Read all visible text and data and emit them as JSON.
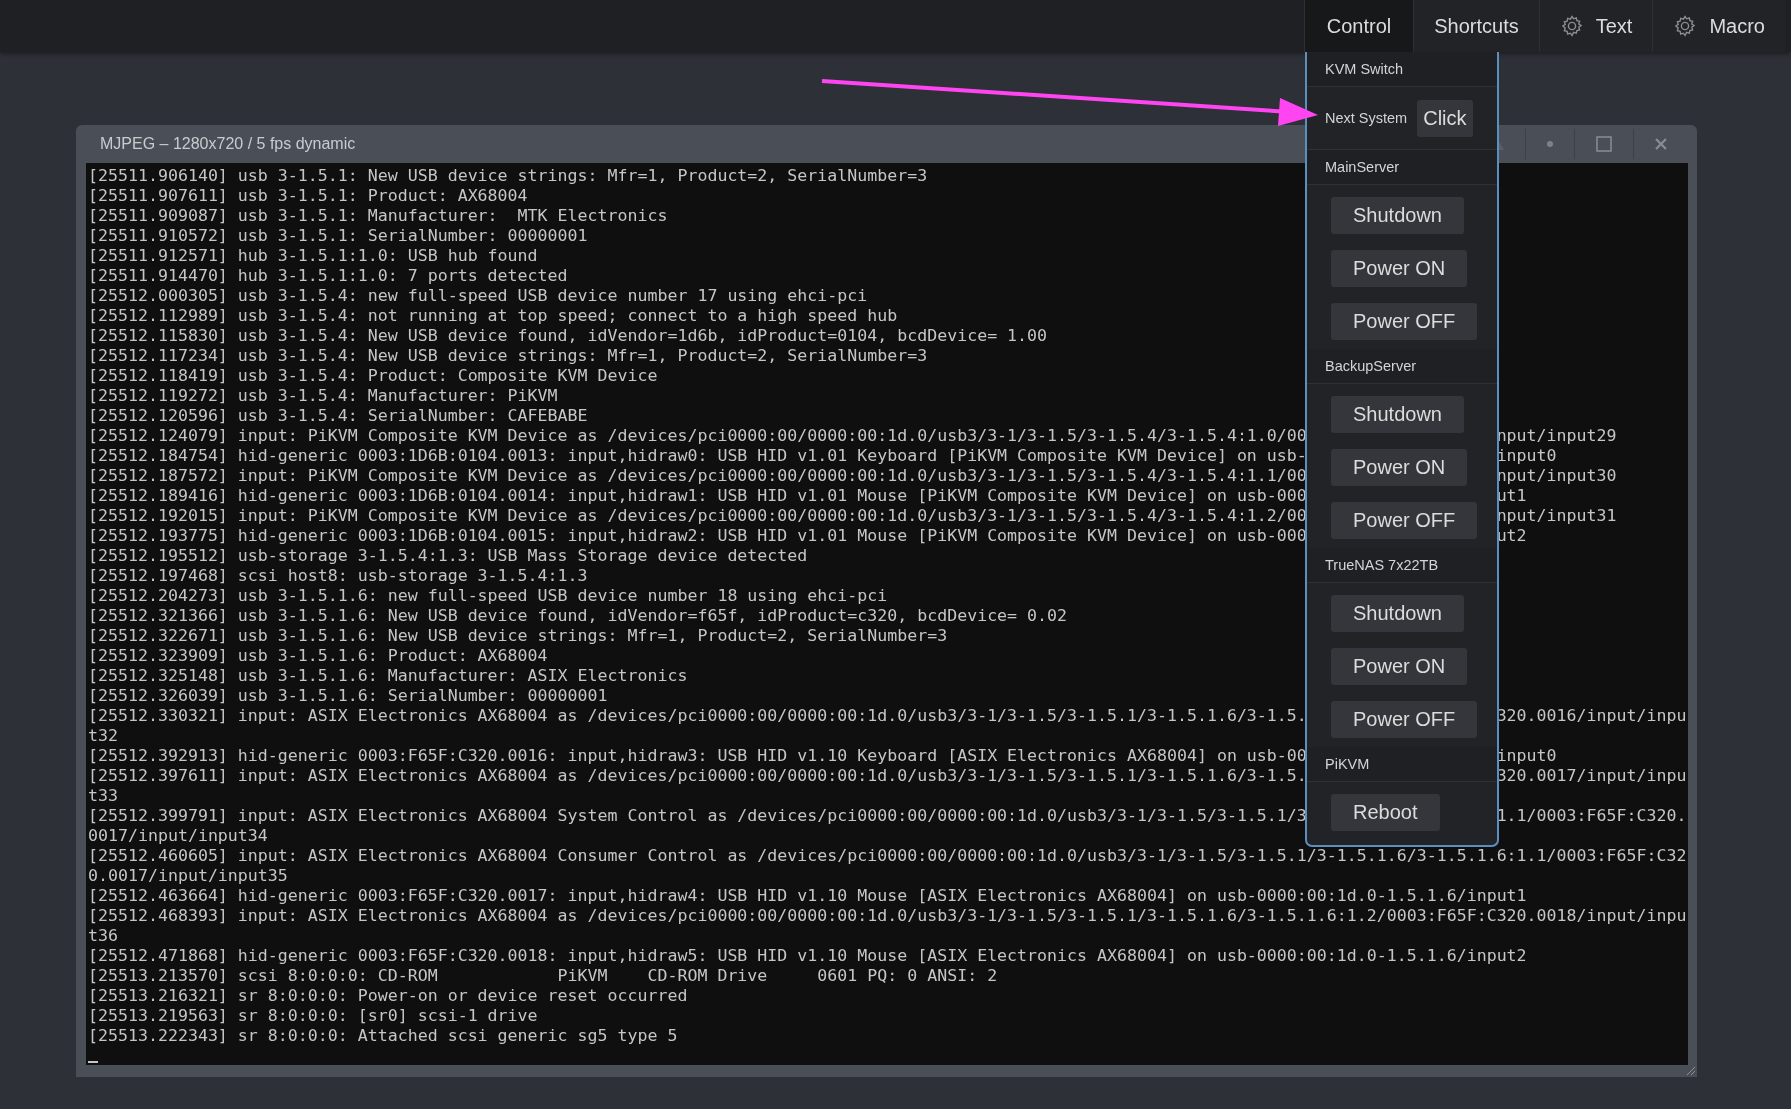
{
  "top_bar": {
    "tabs": [
      {
        "label": "Control",
        "kind": "text",
        "selected": true
      },
      {
        "label": "Shortcuts",
        "kind": "text",
        "selected": false
      },
      {
        "label": "Text",
        "kind": "icon",
        "selected": false
      },
      {
        "label": "Macro",
        "kind": "icon",
        "selected": false
      }
    ]
  },
  "stream_window": {
    "title": "MJPEG – 1280x720 / 5 fps dynamic",
    "console_lines": [
      {
        "left": "[25511.906140] usb 3-1.5.1: New USB device strings: Mfr=1, Product=2, SerialNumber=3"
      },
      {
        "left": "[25511.907611] usb 3-1.5.1: Product: AX68004"
      },
      {
        "left": "[25511.909087] usb 3-1.5.1: Manufacturer:  MTK Electronics"
      },
      {
        "left": "[25511.910572] usb 3-1.5.1: SerialNumber: 00000001"
      },
      {
        "left": "[25511.912571] hub 3-1.5.1:1.0: USB hub found"
      },
      {
        "left": "[25511.914470] hub 3-1.5.1:1.0: 7 ports detected"
      },
      {
        "left": "[25512.000305] usb 3-1.5.4: new full-speed USB device number 17 using ehci-pci"
      },
      {
        "left": "[25512.112989] usb 3-1.5.4: not running at top speed; connect to a high speed hub"
      },
      {
        "left": "[25512.115830] usb 3-1.5.4: New USB device found, idVendor=1d6b, idProduct=0104, bcdDevice= 1.00"
      },
      {
        "left": "[25512.117234] usb 3-1.5.4: New USB device strings: Mfr=1, Product=2, SerialNumber=3"
      },
      {
        "left": "[25512.118419] usb 3-1.5.4: Product: Composite KVM Device"
      },
      {
        "left": "[25512.119272] usb 3-1.5.4: Manufacturer: PiKVM"
      },
      {
        "left": "[25512.120596] usb 3-1.5.4: SerialNumber: CAFEBABE"
      },
      {
        "left": "[25512.124079] input: PiKVM Composite KVM Device as /devices/pci0000:00/0000:00:1d.0/usb3/3-1/3-1.5/3-1.5.4/3-1.5.4:1.0/00",
        "right": "nput/input29"
      },
      {
        "left": "[25512.184754] hid-generic 0003:1D6B:0104.0013: input,hidraw0: USB HID v1.01 Keyboard [PiKVM Composite KVM Device] on usb-",
        "right": "input0"
      },
      {
        "left": "[25512.187572] input: PiKVM Composite KVM Device as /devices/pci0000:00/0000:00:1d.0/usb3/3-1/3-1.5/3-1.5.4/3-1.5.4:1.1/00",
        "right": "nput/input30"
      },
      {
        "left": "[25512.189416] hid-generic 0003:1D6B:0104.0014: input,hidraw1: USB HID v1.01 Mouse [PiKVM Composite KVM Device] on usb-000",
        "right": "ut1"
      },
      {
        "left": "[25512.192015] input: PiKVM Composite KVM Device as /devices/pci0000:00/0000:00:1d.0/usb3/3-1/3-1.5/3-1.5.4/3-1.5.4:1.2/00",
        "right": "nput/input31"
      },
      {
        "left": "[25512.193775] hid-generic 0003:1D6B:0104.0015: input,hidraw2: USB HID v1.01 Mouse [PiKVM Composite KVM Device] on usb-000",
        "right": "ut2"
      },
      {
        "left": "[25512.195512] usb-storage 3-1.5.4:1.3: USB Mass Storage device detected"
      },
      {
        "left": "[25512.197468] scsi host8: usb-storage 3-1.5.4:1.3"
      },
      {
        "left": "[25512.204273] usb 3-1.5.1.6: new full-speed USB device number 18 using ehci-pci"
      },
      {
        "left": "[25512.321366] usb 3-1.5.1.6: New USB device found, idVendor=f65f, idProduct=c320, bcdDevice= 0.02"
      },
      {
        "left": "[25512.322671] usb 3-1.5.1.6: New USB device strings: Mfr=1, Product=2, SerialNumber=3"
      },
      {
        "left": "[25512.323909] usb 3-1.5.1.6: Product: AX68004"
      },
      {
        "left": "[25512.325148] usb 3-1.5.1.6: Manufacturer: ASIX Electronics"
      },
      {
        "left": "[25512.326039] usb 3-1.5.1.6: SerialNumber: 00000001"
      },
      {
        "left": "[25512.330321] input: ASIX Electronics AX68004 as /devices/pci0000:00/0000:00:1d.0/usb3/3-1/3-1.5/3-1.5.1/3-1.5.1.6/3-1.5.",
        "right": "320.0016/input/inpu"
      },
      {
        "left": "t32"
      },
      {
        "left": "[25512.392913] hid-generic 0003:F65F:C320.0016: input,hidraw3: USB HID v1.10 Keyboard [ASIX Electronics AX68004] on usb-00",
        "right": "input0"
      },
      {
        "left": "[25512.397611] input: ASIX Electronics AX68004 as /devices/pci0000:00/0000:00:1d.0/usb3/3-1/3-1.5/3-1.5.1/3-1.5.1.6/3-1.5.",
        "right": "320.0017/input/inpu"
      },
      {
        "left": "t33"
      },
      {
        "left": "[25512.399791] input: ASIX Electronics AX68004 System Control as /devices/pci0000:00/0000:00:1d.0/usb3/3-1/3-1.5/3-1.5.1/3",
        "right": "1.1/0003:F65F:C320."
      },
      {
        "left": "0017/input/input34"
      },
      {
        "left": "[25512.460605] input: ASIX Electronics AX68004 Consumer Control as /devices/pci0000:00/0000:00:1d.0/usb3/3-1/3-1.5/3-1.5.1/3-1.5.1.6/3-1.5.1.6:1.1/0003:F65F:C32"
      },
      {
        "left": "0.0017/input/input35"
      },
      {
        "left": "[25512.463664] hid-generic 0003:F65F:C320.0017: input,hidraw4: USB HID v1.10 Mouse [ASIX Electronics AX68004] on usb-0000:00:1d.0-1.5.1.6/input1"
      },
      {
        "left": "[25512.468393] input: ASIX Electronics AX68004 as /devices/pci0000:00/0000:00:1d.0/usb3/3-1/3-1.5/3-1.5.1/3-1.5.1.6/3-1.5.1.6:1.2/0003:F65F:C320.0018/input/inpu"
      },
      {
        "left": "t36"
      },
      {
        "left": "[25512.471868] hid-generic 0003:F65F:C320.0018: input,hidraw5: USB HID v1.10 Mouse [ASIX Electronics AX68004] on usb-0000:00:1d.0-1.5.1.6/input2"
      },
      {
        "left": "[25513.213570] scsi 8:0:0:0: CD-ROM            PiKVM    CD-ROM Drive     0601 PQ: 0 ANSI: 2"
      },
      {
        "left": "[25513.216321] sr 8:0:0:0: Power-on or device reset occurred"
      },
      {
        "left": "[25513.219563] sr 8:0:0:0: [sr0] scsi-1 drive"
      },
      {
        "left": "[25513.222343] sr 8:0:0:0: Attached scsi generic sg5 type 5"
      }
    ]
  },
  "control_menu": {
    "sections": [
      {
        "title": "KVM Switch",
        "items": [
          {
            "kind": "row",
            "label": "Next System",
            "button": "Click"
          }
        ]
      },
      {
        "title": "MainServer",
        "items": [
          {
            "kind": "button",
            "label": "Shutdown"
          },
          {
            "kind": "button",
            "label": "Power ON"
          },
          {
            "kind": "button",
            "label": "Power OFF"
          }
        ]
      },
      {
        "title": "BackupServer",
        "items": [
          {
            "kind": "button",
            "label": "Shutdown"
          },
          {
            "kind": "button",
            "label": "Power ON"
          },
          {
            "kind": "button",
            "label": "Power OFF"
          }
        ]
      },
      {
        "title": "TrueNAS 7x22TB",
        "items": [
          {
            "kind": "button",
            "label": "Shutdown"
          },
          {
            "kind": "button",
            "label": "Power ON"
          },
          {
            "kind": "button",
            "label": "Power OFF"
          }
        ]
      },
      {
        "title": "PiKVM",
        "items": [
          {
            "kind": "button",
            "label": "Reboot"
          }
        ]
      }
    ]
  }
}
